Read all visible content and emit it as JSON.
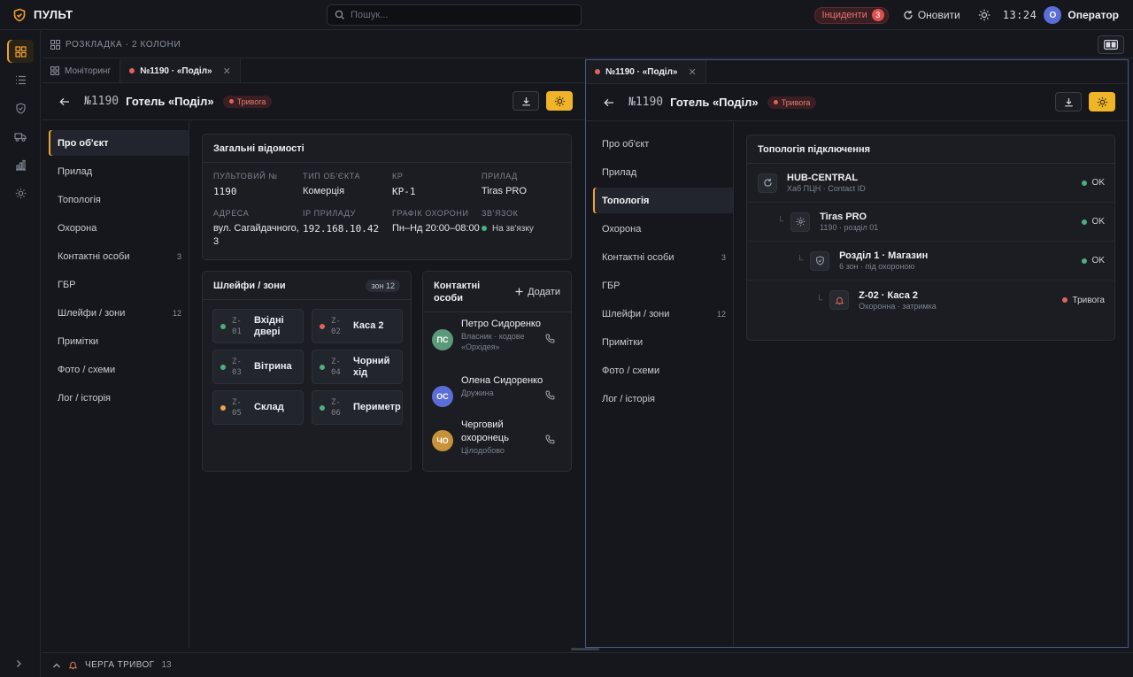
{
  "app": {
    "title": "ПУЛЬТ"
  },
  "search": {
    "placeholder": "Пошук..."
  },
  "topbar": {
    "incidents_label": "Інциденти",
    "incidents_count": "3",
    "refresh_label": "Оновити",
    "time": "13:24",
    "avatar": "O",
    "user": "Оператор"
  },
  "layout": {
    "label": "РОЗКЛАДКА · 2 КОЛОНИ"
  },
  "left_tabs": [
    {
      "label": "Моніторинг"
    },
    {
      "label": "№1190 · «Поділ»"
    }
  ],
  "right_tabs": [
    {
      "label": "№1190 · «Поділ»"
    }
  ],
  "object": {
    "number": "№1190",
    "name": "Готель «Поділ»",
    "status": "Тривога"
  },
  "nav": [
    {
      "label": "Про об'єкт",
      "count": ""
    },
    {
      "label": "Прилад",
      "count": ""
    },
    {
      "label": "Топологія",
      "count": ""
    },
    {
      "label": "Охорона",
      "count": ""
    },
    {
      "label": "Контактні особи",
      "count": "3"
    },
    {
      "label": "ГБР",
      "count": ""
    },
    {
      "label": "Шлейфи / зони",
      "count": "12"
    },
    {
      "label": "Примітки",
      "count": ""
    },
    {
      "label": "Фото / схеми",
      "count": ""
    },
    {
      "label": "Лог / історія",
      "count": ""
    }
  ],
  "general": {
    "title": "Загальні відомості",
    "fields": [
      {
        "label": "ПУЛЬТОВИЙ №",
        "value": "1190"
      },
      {
        "label": "ТИП ОБ'ЄКТА",
        "value": "Комерція"
      },
      {
        "label": "КР",
        "value": "КР-1"
      },
      {
        "label": "ПРИЛАД",
        "value": "Tiras PRO"
      },
      {
        "label": "АДРЕСА",
        "value": "вул. Сагайдачного, 3"
      },
      {
        "label": "IP ПРИЛАДУ",
        "value": "192.168.10.42"
      },
      {
        "label": "ГРАФІК ОХОРОНИ",
        "value": "Пн–Нд 20:00–08:00"
      },
      {
        "label": "ЗВ'ЯЗОК",
        "value": "На зв'язку"
      }
    ]
  },
  "zones": {
    "title": "Шлейфи / зони",
    "count_label": "зон 12",
    "items": [
      {
        "code": "Z-01",
        "name": "Вхідні двері",
        "color": "#4caf7d"
      },
      {
        "code": "Z-02",
        "name": "Каса 2",
        "color": "#e0645c"
      },
      {
        "code": "Z-03",
        "name": "Вітрина",
        "color": "#4caf7d"
      },
      {
        "code": "Z-04",
        "name": "Чорний хід",
        "color": "#4caf7d"
      },
      {
        "code": "Z-05",
        "name": "Склад",
        "color": "#f0a24a"
      },
      {
        "code": "Z-06",
        "name": "Периметр",
        "color": "#4caf7d"
      }
    ]
  },
  "contacts": {
    "title": "Контактні особи",
    "add_label": "Додати",
    "items": [
      {
        "initials": "ПС",
        "name": "Петро Сидоренко",
        "role": "Власник · кодове «Орхідея»",
        "color": "#5a9a78"
      },
      {
        "initials": "ОС",
        "name": "Олена Сидоренко",
        "role": "Дружина",
        "color": "#5b6ed8"
      },
      {
        "initials": "ЧО",
        "name": "Черговий охоронець",
        "role": "Цілодобово",
        "color": "#c7923a"
      }
    ]
  },
  "topology": {
    "title": "Топологія підключення",
    "nodes": [
      {
        "name": "HUB-CENTRAL",
        "sub": "Хаб ПЦН · Contact ID",
        "status": "OK",
        "status_color": "#4caf7d",
        "icon": "refresh-icon"
      },
      {
        "name": "Tiras PRO",
        "sub": "1190 · розділ 01",
        "status": "OK",
        "status_color": "#4caf7d",
        "icon": "gear-icon"
      },
      {
        "name": "Розділ 1 · Магазин",
        "sub": "6 зон · під охороною",
        "status": "OK",
        "status_color": "#4caf7d",
        "icon": "shield-icon"
      },
      {
        "name": "Z-02 · Каса 2",
        "sub": "Охоронна · затримка",
        "status": "Тривога",
        "status_color": "#e0645c",
        "icon": "bell-icon"
      }
    ]
  },
  "bottom": {
    "label": "ЧЕРГА ТРИВОГ",
    "count": "13"
  },
  "colors": {
    "accent": "#f0a22a",
    "alarm": "#e0645c",
    "ok": "#4caf7d"
  }
}
